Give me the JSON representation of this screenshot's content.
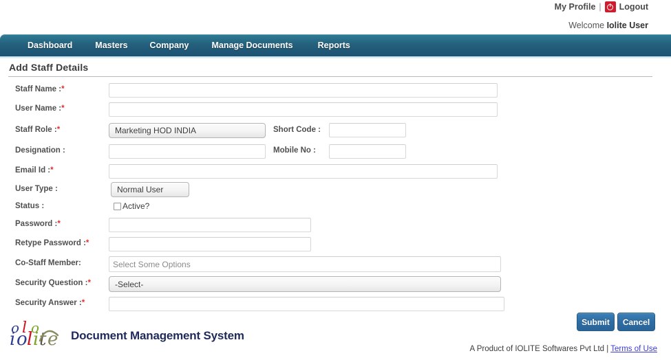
{
  "topbar": {
    "my_profile": "My Profile",
    "separator": "|",
    "logout": "Logout",
    "logout_icon": "power-icon",
    "welcome_prefix": "Welcome ",
    "welcome_user": "Iolite User"
  },
  "nav": {
    "items": [
      {
        "label": "Dashboard"
      },
      {
        "label": "Masters"
      },
      {
        "label": "Company"
      },
      {
        "label": "Manage Documents"
      },
      {
        "label": "Reports"
      }
    ]
  },
  "page": {
    "title": "Add Staff Details"
  },
  "form": {
    "fields": [
      {
        "label": "Staff Name :",
        "required": true,
        "value": "",
        "placeholder": ""
      },
      {
        "label": "User Name :",
        "required": true,
        "value": "",
        "placeholder": ""
      },
      {
        "label": "Staff Role :",
        "required": true,
        "value": "Marketing HOD INDIA"
      },
      {
        "label": "Short Code :",
        "required": false,
        "value": "",
        "placeholder": ""
      },
      {
        "label": "Designation :",
        "required": false,
        "value": "",
        "placeholder": ""
      },
      {
        "label": "Mobile No :",
        "required": false,
        "value": "",
        "placeholder": ""
      },
      {
        "label": "Email Id :",
        "required": true,
        "value": "",
        "placeholder": ""
      },
      {
        "label": "User Type :",
        "required": false,
        "value": "Normal User"
      },
      {
        "label": "Status :",
        "required": false,
        "checkbox_label": "Active?",
        "checked": false
      },
      {
        "label": "Password :",
        "required": true,
        "value": "",
        "placeholder": ""
      },
      {
        "label": "Retype Password :",
        "required": true,
        "value": "",
        "placeholder": ""
      },
      {
        "label": "Co-Staff Member:",
        "required": false,
        "value": "",
        "placeholder": "Select Some Options"
      },
      {
        "label": "Security Question :",
        "required": true,
        "value": "-Select-"
      },
      {
        "label": "Security Answer :",
        "required": true,
        "value": "",
        "placeholder": ""
      }
    ],
    "required_marker": "*"
  },
  "actions": {
    "submit_label": "Submit",
    "cancel_label": "Cancel"
  },
  "footer": {
    "logo_text": "iolite",
    "brand": "Document Management System",
    "product_text": "A Product of IOLITE Softwares Pvt Ltd | ",
    "terms_label": "Terms of Use"
  },
  "colors": {
    "nav_gradient_top": "#2f7d96",
    "nav_gradient_bottom": "#1d5273",
    "button_blue": "#2e6da4",
    "required_red": "#e03030",
    "logout_red": "#cf1b2b",
    "link_blue": "#3b3bd6",
    "brand_navy": "#1f2a5a"
  }
}
